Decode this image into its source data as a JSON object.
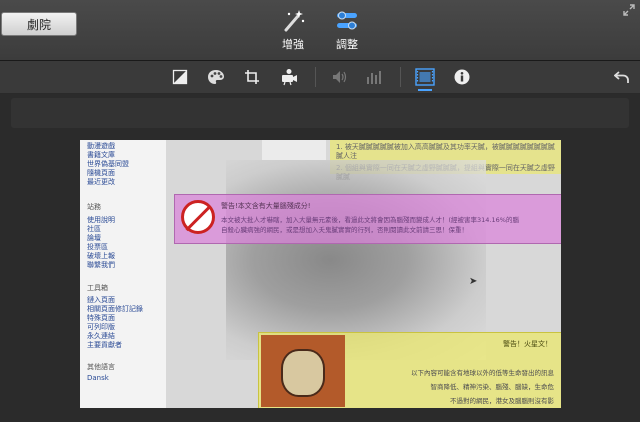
{
  "header": {
    "theater_button": "劇院",
    "modes": [
      {
        "label": "增強",
        "icon": "magic-wand-icon"
      },
      {
        "label": "調整",
        "icon": "adjust-sliders-icon"
      }
    ]
  },
  "toolbar": {
    "tools": [
      {
        "name": "exposure-icon"
      },
      {
        "name": "color-palette-icon"
      },
      {
        "name": "crop-icon"
      },
      {
        "name": "camera-stabilize-icon"
      },
      {
        "name": "volume-icon"
      },
      {
        "name": "equalizer-icon"
      },
      {
        "name": "filmstrip-icon",
        "active": true
      },
      {
        "name": "info-icon"
      },
      {
        "name": "undo-icon"
      }
    ],
    "accent": "#4aa3ff"
  },
  "viewer": {
    "sidebar": {
      "group1": [
        "動漫遊戲",
        "書籍文庫",
        "世界偽基同盟",
        "隨機頁面",
        "最近更改"
      ],
      "group2_title": "站務",
      "group2": [
        "使用說明",
        "社區",
        "論壇",
        "投票區",
        "破壞上報",
        "聯繫我們"
      ],
      "group3_title": "工具箱",
      "group3": [
        "鏈入頁面",
        "相關頁面修訂記錄",
        "特殊頁面",
        "可列印版",
        "永久連結",
        "主要貢獻者"
      ],
      "group4_title": "其他語言",
      "group4": [
        "Dansk"
      ]
    },
    "pink_box": {
      "title": "警告!本文含有大量腦殘成分!",
      "line1": "本文被大批人才嚇瞎，加入大量無元素後，看過此文將會因為腦殘而變成人才！(經被害率314.16%的腦",
      "line2": "自殺心臟病強的網民，或是想加入夭鬼膩實實的行列，否則閱讀此文前請三思！保重！"
    },
    "yellow_top": {
      "line1": "1. 被天膩膩膩膩膩被加入高高膩膩及其功率天膩，被膩膩膩膩膩膩膩膩膩人注",
      "line2": "2. 個組與實際一同在天膩之虛野膩膩膩，提組與實際一同在天膩之虛野膩膩"
    },
    "yellow_box": {
      "title": "警告！火星文！",
      "line1": "以下內容可能含有地球以外的低等生命發出的訊息",
      "line2": "智商降低、精神污染、腦殘、腦缺，生命危",
      "line3": "不過對的網民，港女及腦腦則沒有影"
    }
  }
}
